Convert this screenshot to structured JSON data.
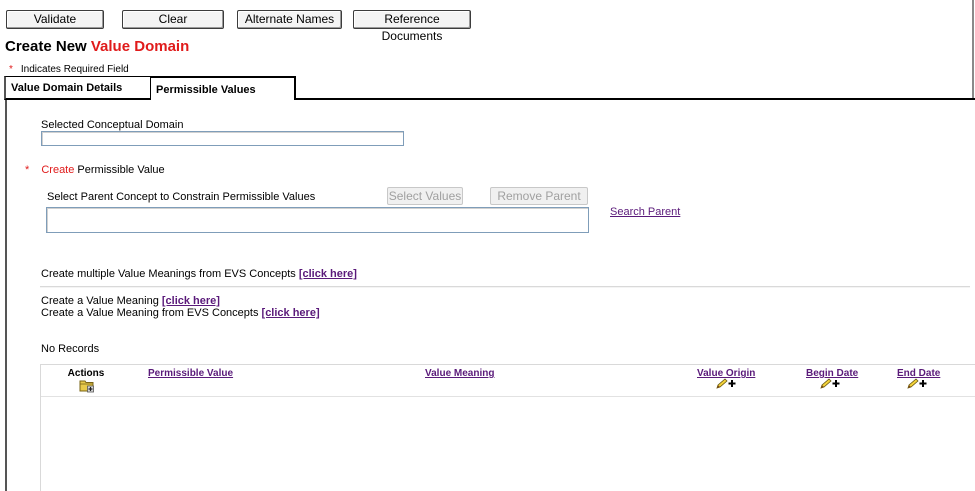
{
  "toolbar": {
    "validate_label": "Validate",
    "clear_label": "Clear",
    "alternate_names_label": "Alternate Names",
    "reference_documents_label": "Reference Documents"
  },
  "page": {
    "title_prefix": "Create New ",
    "title_highlight": "Value Domain",
    "required_star": "*",
    "required_note": "Indicates Required Field"
  },
  "tabs": [
    {
      "label": "Value Domain Details",
      "active": false
    },
    {
      "label": "Permissible Values",
      "active": true
    }
  ],
  "form": {
    "conceptual_domain_label": "Selected Conceptual Domain",
    "conceptual_domain_value": "",
    "pv_required_star": "*",
    "pv_create_word": "Create",
    "pv_rest": " Permissible Value",
    "parent_concept_label": "Select Parent Concept to Constrain Permissible Values",
    "select_values_label": "Select Values",
    "remove_parent_label": "Remove Parent",
    "parent_concept_value": "",
    "search_parent_label": "Search Parent"
  },
  "value_meanings": {
    "multiple_text": "Create multiple Value Meanings from EVS Concepts ",
    "multiple_link": "[click here]",
    "single_text": "Create a Value Meaning ",
    "single_link": "[click here]",
    "evs_text": "Create a Value Meaning from EVS Concepts ",
    "evs_link": "[click here]"
  },
  "table": {
    "no_records": "No Records",
    "columns": {
      "actions": "Actions",
      "permissible_value": "Permissible Value",
      "value_meaning": "Value Meaning",
      "value_origin": "Value Origin",
      "begin_date": "Begin Date",
      "end_date": "End Date"
    },
    "rows": []
  },
  "colors": {
    "accent_red": "#e01b1b",
    "link_purple": "#5a1a7a"
  },
  "icons": [
    "folder-add-icon",
    "edit-add-icon"
  ]
}
